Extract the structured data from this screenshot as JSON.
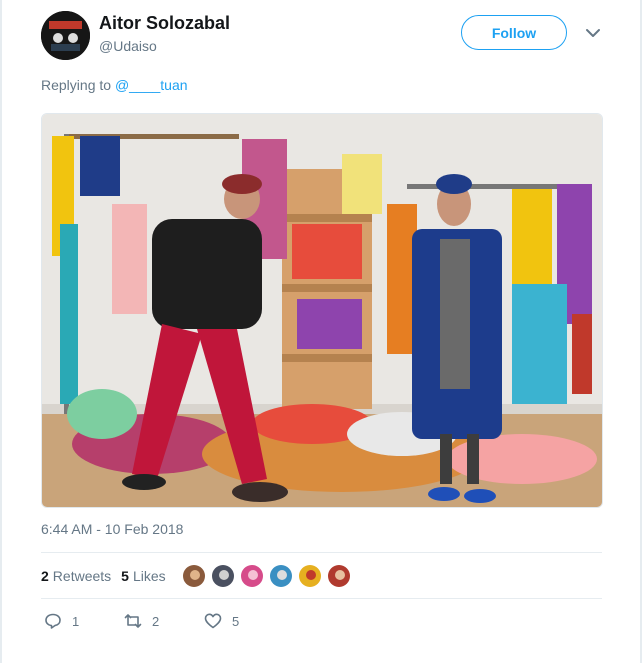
{
  "user": {
    "name": "Aitor Solozabal",
    "handle": "@Udaiso",
    "avatar_icon": "profile-avatar"
  },
  "follow_label": "Follow",
  "reply_context": {
    "prefix": "Replying to ",
    "mention": "@____tuan"
  },
  "timestamp": "6:44 AM - 10 Feb 2018",
  "stats": {
    "retweets_count": "2",
    "retweets_label": "Retweets",
    "likes_count": "5",
    "likes_label": "Likes"
  },
  "actions": {
    "reply_count": "1",
    "retweet_count": "2",
    "like_count": "5"
  },
  "colors": {
    "accent": "#1da1f2",
    "muted": "#657786",
    "text": "#14171a",
    "border": "#e6ecf0"
  }
}
